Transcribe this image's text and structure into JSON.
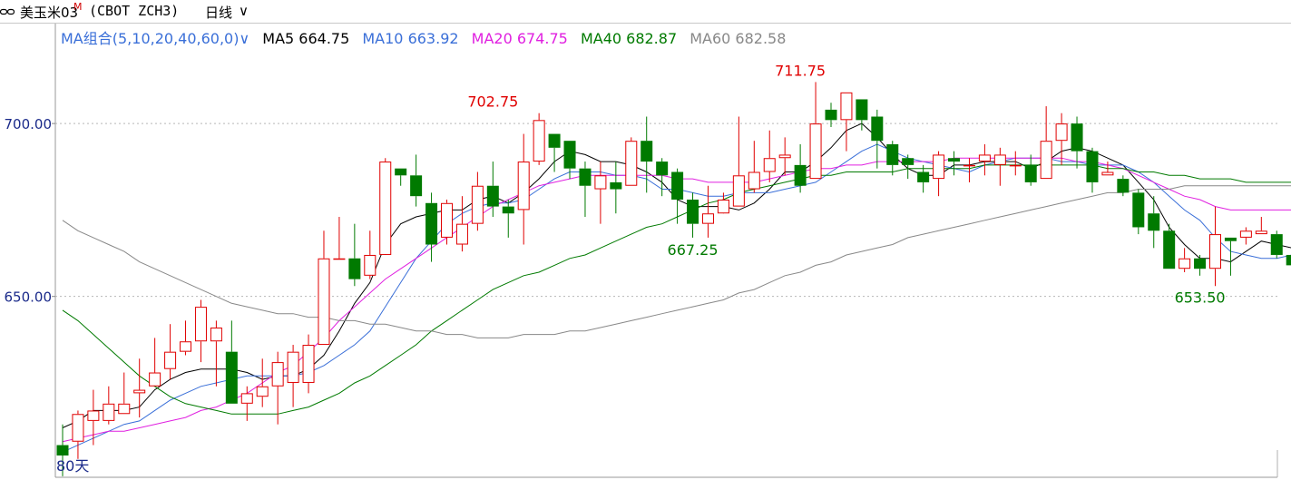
{
  "header": {
    "instrument_name": "美玉米03",
    "instrument_sup": "M",
    "instrument_code": "(CBOT ZCH3)",
    "period_label": "日线",
    "period_caret": "∨"
  },
  "legend": {
    "combo_label": "MA组合(5,10,20,40,60,0)",
    "combo_caret": "∨",
    "items": [
      {
        "label": "MA5 664.75",
        "color": "#000000"
      },
      {
        "label": "MA10 663.92",
        "color": "#3a6fd8"
      },
      {
        "label": "MA20 674.75",
        "color": "#e020e0"
      },
      {
        "label": "MA40 682.87",
        "color": "#007a00"
      },
      {
        "label": "MA60 682.58",
        "color": "#888888"
      }
    ]
  },
  "footer": {
    "days_label": "80天"
  },
  "chart_data": {
    "type": "candlestick",
    "y_ticks": [
      "700.00",
      "650.00"
    ],
    "y_tick_values": [
      700,
      650
    ],
    "ylim": [
      597.7,
      728.9
    ],
    "grid": "horizontal dashed at tick values",
    "up_color": "#e00000",
    "down_color": "#007a00",
    "annotations": [
      {
        "text": "702.75",
        "index": 28,
        "value": 702.75,
        "color": "#e00000"
      },
      {
        "text": "711.75",
        "index": 48,
        "value": 711.75,
        "color": "#e00000"
      },
      {
        "text": "667.25",
        "index": 41,
        "value": 667.25,
        "color": "#007a00"
      },
      {
        "text": "653.50",
        "index": 74,
        "value": 653.5,
        "color": "#007a00"
      }
    ],
    "candles": [
      [
        607,
        604,
        613,
        598
      ],
      [
        608,
        616,
        617,
        603
      ],
      [
        614,
        617,
        623,
        607
      ],
      [
        614,
        619,
        624,
        613
      ],
      [
        616,
        619,
        628,
        616
      ],
      [
        622,
        623,
        632,
        615
      ],
      [
        624,
        628,
        638,
        624
      ],
      [
        629,
        634,
        642,
        626
      ],
      [
        634,
        637,
        643,
        633
      ],
      [
        637,
        647,
        649,
        631
      ],
      [
        637,
        641,
        643,
        624
      ],
      [
        634,
        619,
        643,
        619
      ],
      [
        619,
        622,
        624,
        614
      ],
      [
        621,
        624,
        632,
        618
      ],
      [
        624,
        631,
        634,
        613
      ],
      [
        625,
        634,
        636,
        618
      ],
      [
        625,
        636,
        639,
        622
      ],
      [
        636,
        661,
        669,
        636
      ],
      [
        661,
        661,
        673,
        661
      ],
      [
        661,
        655,
        671,
        653
      ],
      [
        656,
        662,
        669,
        655
      ],
      [
        662,
        689,
        690,
        670
      ],
      [
        687,
        685,
        687,
        682
      ],
      [
        685,
        679,
        691,
        676
      ],
      [
        677,
        665,
        680,
        660
      ],
      [
        667,
        677,
        678,
        665
      ],
      [
        665,
        671,
        679,
        663
      ],
      [
        671,
        682,
        686,
        669
      ],
      [
        682,
        676,
        689,
        673
      ],
      [
        676,
        674,
        678,
        667
      ],
      [
        675,
        689,
        697,
        665
      ],
      [
        689,
        701,
        703,
        688
      ],
      [
        697,
        693,
        697,
        686
      ],
      [
        695,
        687,
        695,
        684
      ],
      [
        687,
        682,
        689,
        673
      ],
      [
        681,
        685,
        689,
        671
      ],
      [
        683,
        681,
        689,
        674
      ],
      [
        682,
        695,
        696,
        682
      ],
      [
        695,
        689,
        702,
        680
      ],
      [
        689,
        685,
        690,
        679
      ],
      [
        686,
        678,
        687,
        671
      ],
      [
        678,
        671,
        680,
        667
      ],
      [
        671,
        674,
        682,
        667
      ],
      [
        674,
        678,
        680,
        675
      ],
      [
        676,
        685,
        702,
        676
      ],
      [
        681,
        686,
        695,
        680
      ],
      [
        686,
        690,
        698,
        683
      ],
      [
        690,
        691,
        696,
        685
      ],
      [
        688,
        682,
        694,
        680
      ],
      [
        684,
        700,
        712,
        684
      ],
      [
        704,
        701,
        706,
        699
      ],
      [
        701,
        709,
        709,
        692
      ],
      [
        707,
        701,
        707,
        698
      ],
      [
        702,
        695,
        704,
        687
      ],
      [
        694,
        688,
        695,
        685
      ],
      [
        690,
        688,
        691,
        684
      ],
      [
        686,
        683,
        688,
        680
      ],
      [
        684,
        691,
        692,
        679
      ],
      [
        690,
        689,
        692,
        685
      ],
      [
        688,
        688,
        690,
        683
      ],
      [
        689,
        691,
        694,
        685
      ],
      [
        688,
        691,
        693,
        682
      ],
      [
        688,
        688,
        692,
        685
      ],
      [
        688,
        683,
        691,
        682
      ],
      [
        684,
        695,
        705,
        684
      ],
      [
        695,
        700,
        703,
        688
      ],
      [
        700,
        692,
        702,
        687
      ],
      [
        692,
        683,
        693,
        680
      ],
      [
        685,
        686,
        689,
        685
      ],
      [
        684,
        680,
        685,
        679
      ],
      [
        680,
        670,
        681,
        668
      ],
      [
        674,
        669,
        679,
        664
      ],
      [
        669,
        658,
        671,
        658
      ],
      [
        658,
        661,
        664,
        657
      ],
      [
        661,
        658,
        662,
        656
      ],
      [
        658,
        668,
        676,
        653
      ],
      [
        667,
        666,
        667,
        656
      ],
      [
        667,
        669,
        670,
        665
      ],
      [
        668,
        669,
        673,
        668
      ],
      [
        668,
        662,
        669,
        661
      ],
      [
        662,
        659,
        662,
        659
      ],
      [
        659,
        662,
        663,
        658
      ]
    ],
    "ma_series": [
      {
        "name": "MA5",
        "color": "#000000",
        "values": [
          612,
          614,
          617,
          617,
          617,
          618,
          623,
          626,
          628,
          629,
          629,
          629,
          628,
          626,
          627,
          627,
          629,
          633,
          640,
          648,
          654,
          665,
          671,
          673,
          674,
          675,
          675,
          678,
          679,
          677,
          680,
          684,
          689,
          692,
          691,
          689,
          689,
          688,
          686,
          683,
          678,
          676,
          676,
          676,
          675,
          677,
          681,
          686,
          686,
          689,
          693,
          698,
          700,
          696,
          691,
          687,
          685,
          685,
          688,
          688,
          689,
          689,
          689,
          687,
          689,
          692,
          693,
          692,
          690,
          688,
          683,
          678,
          670,
          665,
          661,
          661,
          660,
          663,
          666,
          665,
          664,
          664.75
        ]
      },
      {
        "name": "MA10",
        "color": "#3a6fd8",
        "values": [
          605,
          607,
          609,
          611,
          613,
          614,
          617,
          620,
          622,
          624,
          625,
          626,
          627,
          627,
          627,
          627,
          628,
          630,
          633,
          636,
          640,
          647,
          654,
          661,
          666,
          671,
          674,
          676,
          677,
          677,
          678,
          681,
          684,
          686,
          686,
          686,
          685,
          685,
          684,
          681,
          681,
          680,
          679,
          679,
          680,
          680,
          680,
          681,
          682,
          683,
          686,
          689,
          692,
          694,
          692,
          690,
          689,
          688,
          687,
          686,
          688,
          689,
          690,
          690,
          690,
          689,
          689,
          688,
          688,
          688,
          686,
          683,
          679,
          675,
          672,
          667,
          663,
          662,
          661,
          661,
          662,
          663.92
        ]
      },
      {
        "name": "MA20",
        "color": "#e020e0",
        "values": [
          608,
          609,
          610,
          611,
          611,
          612,
          613,
          614,
          615,
          617,
          618,
          620,
          622,
          625,
          628,
          630,
          634,
          638,
          643,
          647,
          651,
          655,
          658,
          661,
          664,
          667,
          670,
          673,
          676,
          678,
          680,
          682,
          683,
          684,
          685,
          685,
          685,
          685,
          685,
          685,
          684,
          684,
          683,
          683,
          683,
          683,
          684,
          685,
          686,
          687,
          687,
          688,
          688,
          689,
          689,
          689,
          689,
          689,
          690,
          690,
          690,
          690,
          690,
          690,
          690,
          690,
          689,
          689,
          688,
          687,
          685,
          683,
          681,
          679,
          678,
          676,
          675,
          675,
          675,
          675,
          675,
          674.75
        ]
      },
      {
        "name": "MA40",
        "color": "#007a00",
        "values": [
          646,
          643,
          639,
          635,
          631,
          627,
          624,
          621,
          619,
          618,
          617,
          616,
          616,
          616,
          616,
          617,
          618,
          620,
          622,
          625,
          627,
          630,
          633,
          636,
          640,
          643,
          646,
          649,
          652,
          654,
          656,
          657,
          659,
          661,
          662,
          664,
          666,
          668,
          670,
          671,
          673,
          675,
          677,
          678,
          680,
          681,
          682,
          683,
          684,
          685,
          685,
          686,
          686,
          686,
          686,
          687,
          687,
          687,
          687,
          687,
          688,
          688,
          688,
          688,
          688,
          688,
          688,
          688,
          687,
          687,
          686,
          686,
          685,
          685,
          684,
          684,
          684,
          683,
          683,
          683,
          683,
          682.87
        ]
      },
      {
        "name": "MA60",
        "color": "#888888",
        "values": [
          672,
          669,
          667,
          665,
          663,
          660,
          658,
          656,
          654,
          652,
          650,
          648,
          647,
          646,
          645,
          645,
          644,
          644,
          643,
          643,
          642,
          642,
          641,
          640,
          640,
          639,
          639,
          638,
          638,
          638,
          639,
          639,
          639,
          640,
          640,
          641,
          642,
          643,
          644,
          645,
          646,
          647,
          648,
          649,
          651,
          652,
          654,
          656,
          657,
          659,
          660,
          662,
          663,
          664,
          665,
          667,
          668,
          669,
          670,
          671,
          672,
          673,
          674,
          675,
          676,
          677,
          678,
          679,
          680,
          680,
          681,
          681,
          681,
          682,
          682,
          682,
          682,
          682,
          682,
          682,
          682,
          682.58
        ]
      }
    ]
  }
}
